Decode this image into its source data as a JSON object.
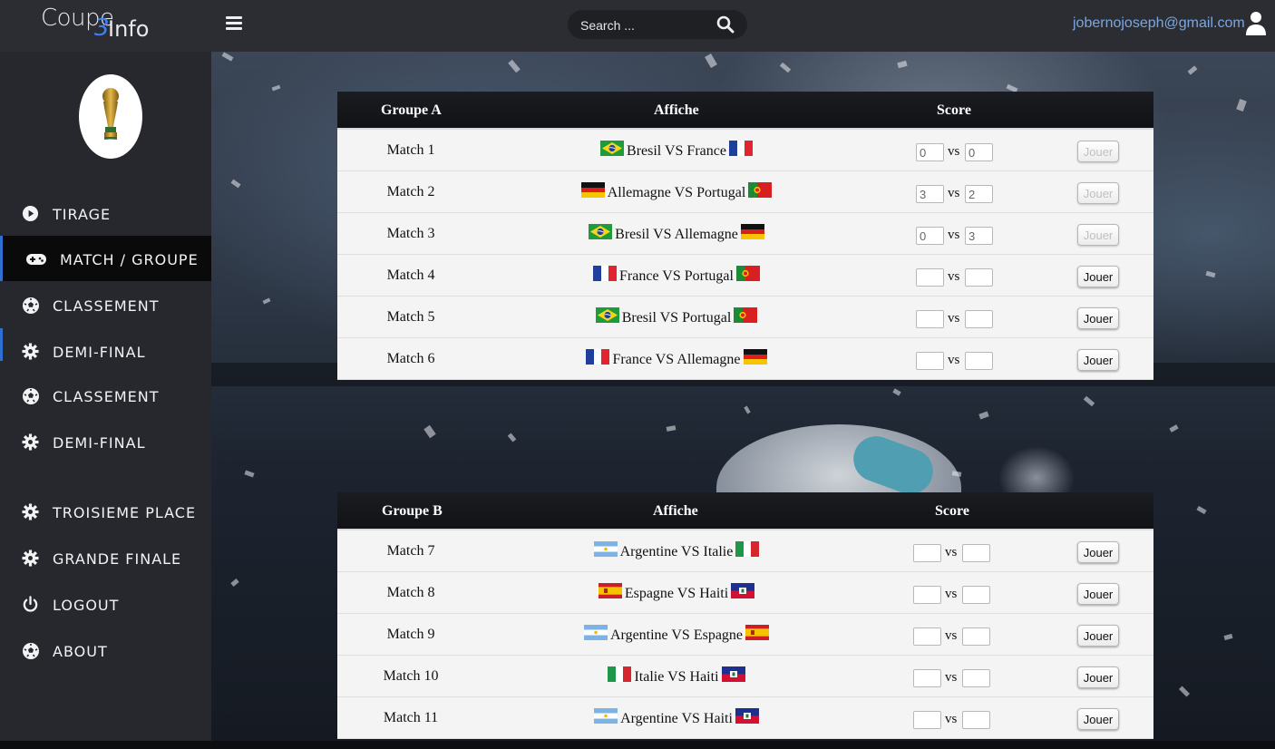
{
  "app": {
    "logo_text": "Coupe",
    "logo_number": "3",
    "logo_suffix": "Info"
  },
  "header": {
    "search_placeholder": "Search ...",
    "user_email": "jobernojoseph@gmail.com",
    "icons": {
      "menu": "hamburger-icon",
      "search": "search-icon",
      "user": "user-icon"
    }
  },
  "sidebar": {
    "avatar": "world-cup-trophy",
    "items": [
      {
        "label": "TIRAGE",
        "icon": "play-circle-icon"
      },
      {
        "label": "MATCH / GROUPE",
        "icon": "gamepad-icon",
        "active": true
      },
      {
        "label": "CLASSEMENT",
        "icon": "soccer-ball-icon"
      },
      {
        "label": "DEMI-FINAL",
        "icon": "gear-icon"
      },
      {
        "label": "CLASSEMENT",
        "icon": "soccer-ball-icon"
      },
      {
        "label": "DEMI-FINAL",
        "icon": "gear-icon"
      },
      {
        "label": "TROISIEME PLACE",
        "icon": "gear-icon"
      },
      {
        "label": "GRANDE FINALE",
        "icon": "gear-icon"
      },
      {
        "label": "LOGOUT",
        "icon": "power-icon"
      },
      {
        "label": "ABOUT",
        "icon": "soccer-ball-icon"
      }
    ]
  },
  "groups": [
    {
      "title": "Groupe A",
      "col_affiche": "Affiche",
      "col_score": "Score",
      "matches": [
        {
          "name": "Match 1",
          "team1": "Bresil",
          "team2": "France",
          "vs": "VS",
          "flag1": "brazil",
          "flag2": "france",
          "score1": "0",
          "score2": "0",
          "played": true,
          "button": "Jouer"
        },
        {
          "name": "Match 2",
          "team1": "Allemagne",
          "team2": "Portugal",
          "vs": "VS",
          "flag1": "germany",
          "flag2": "portugal",
          "score1": "3",
          "score2": "2",
          "played": true,
          "button": "Jouer"
        },
        {
          "name": "Match 3",
          "team1": "Bresil",
          "team2": "Allemagne",
          "vs": "VS",
          "flag1": "brazil",
          "flag2": "germany",
          "score1": "0",
          "score2": "3",
          "played": true,
          "button": "Jouer"
        },
        {
          "name": "Match 4",
          "team1": "France",
          "team2": "Portugal",
          "vs": "VS",
          "flag1": "france",
          "flag2": "portugal",
          "score1": "",
          "score2": "",
          "played": false,
          "button": "Jouer"
        },
        {
          "name": "Match 5",
          "team1": "Bresil",
          "team2": "Portugal",
          "vs": "VS",
          "flag1": "brazil",
          "flag2": "portugal",
          "score1": "",
          "score2": "",
          "played": false,
          "button": "Jouer"
        },
        {
          "name": "Match 6",
          "team1": "France",
          "team2": "Allemagne",
          "vs": "VS",
          "flag1": "france",
          "flag2": "germany",
          "score1": "",
          "score2": "",
          "played": false,
          "button": "Jouer"
        }
      ]
    },
    {
      "title": "Groupe B",
      "col_affiche": "Affiche",
      "col_score": "Score",
      "matches": [
        {
          "name": "Match 7",
          "team1": "Argentine",
          "team2": "Italie",
          "vs": "VS",
          "flag1": "argentina",
          "flag2": "italy",
          "score1": "",
          "score2": "",
          "played": false,
          "button": "Jouer"
        },
        {
          "name": "Match 8",
          "team1": "Espagne",
          "team2": "Haiti",
          "vs": "VS",
          "flag1": "spain",
          "flag2": "haiti",
          "score1": "",
          "score2": "",
          "played": false,
          "button": "Jouer"
        },
        {
          "name": "Match 9",
          "team1": "Argentine",
          "team2": "Espagne",
          "vs": "VS",
          "flag1": "argentina",
          "flag2": "spain",
          "score1": "",
          "score2": "",
          "played": false,
          "button": "Jouer"
        },
        {
          "name": "Match 10",
          "team1": "Italie",
          "team2": "Haiti",
          "vs": "VS",
          "flag1": "italy",
          "flag2": "haiti",
          "score1": "",
          "score2": "",
          "played": false,
          "button": "Jouer"
        },
        {
          "name": "Match 11",
          "team1": "Argentine",
          "team2": "Haiti",
          "vs": "VS",
          "flag1": "argentina",
          "flag2": "haiti",
          "score1": "",
          "score2": "",
          "played": false,
          "button": "Jouer"
        }
      ]
    }
  ],
  "score_separator": "vs",
  "colors": {
    "accent": "#2f6fd1",
    "email": "#7aa7e0",
    "sidebar": "#26282d",
    "topbar": "#2b2d33"
  }
}
